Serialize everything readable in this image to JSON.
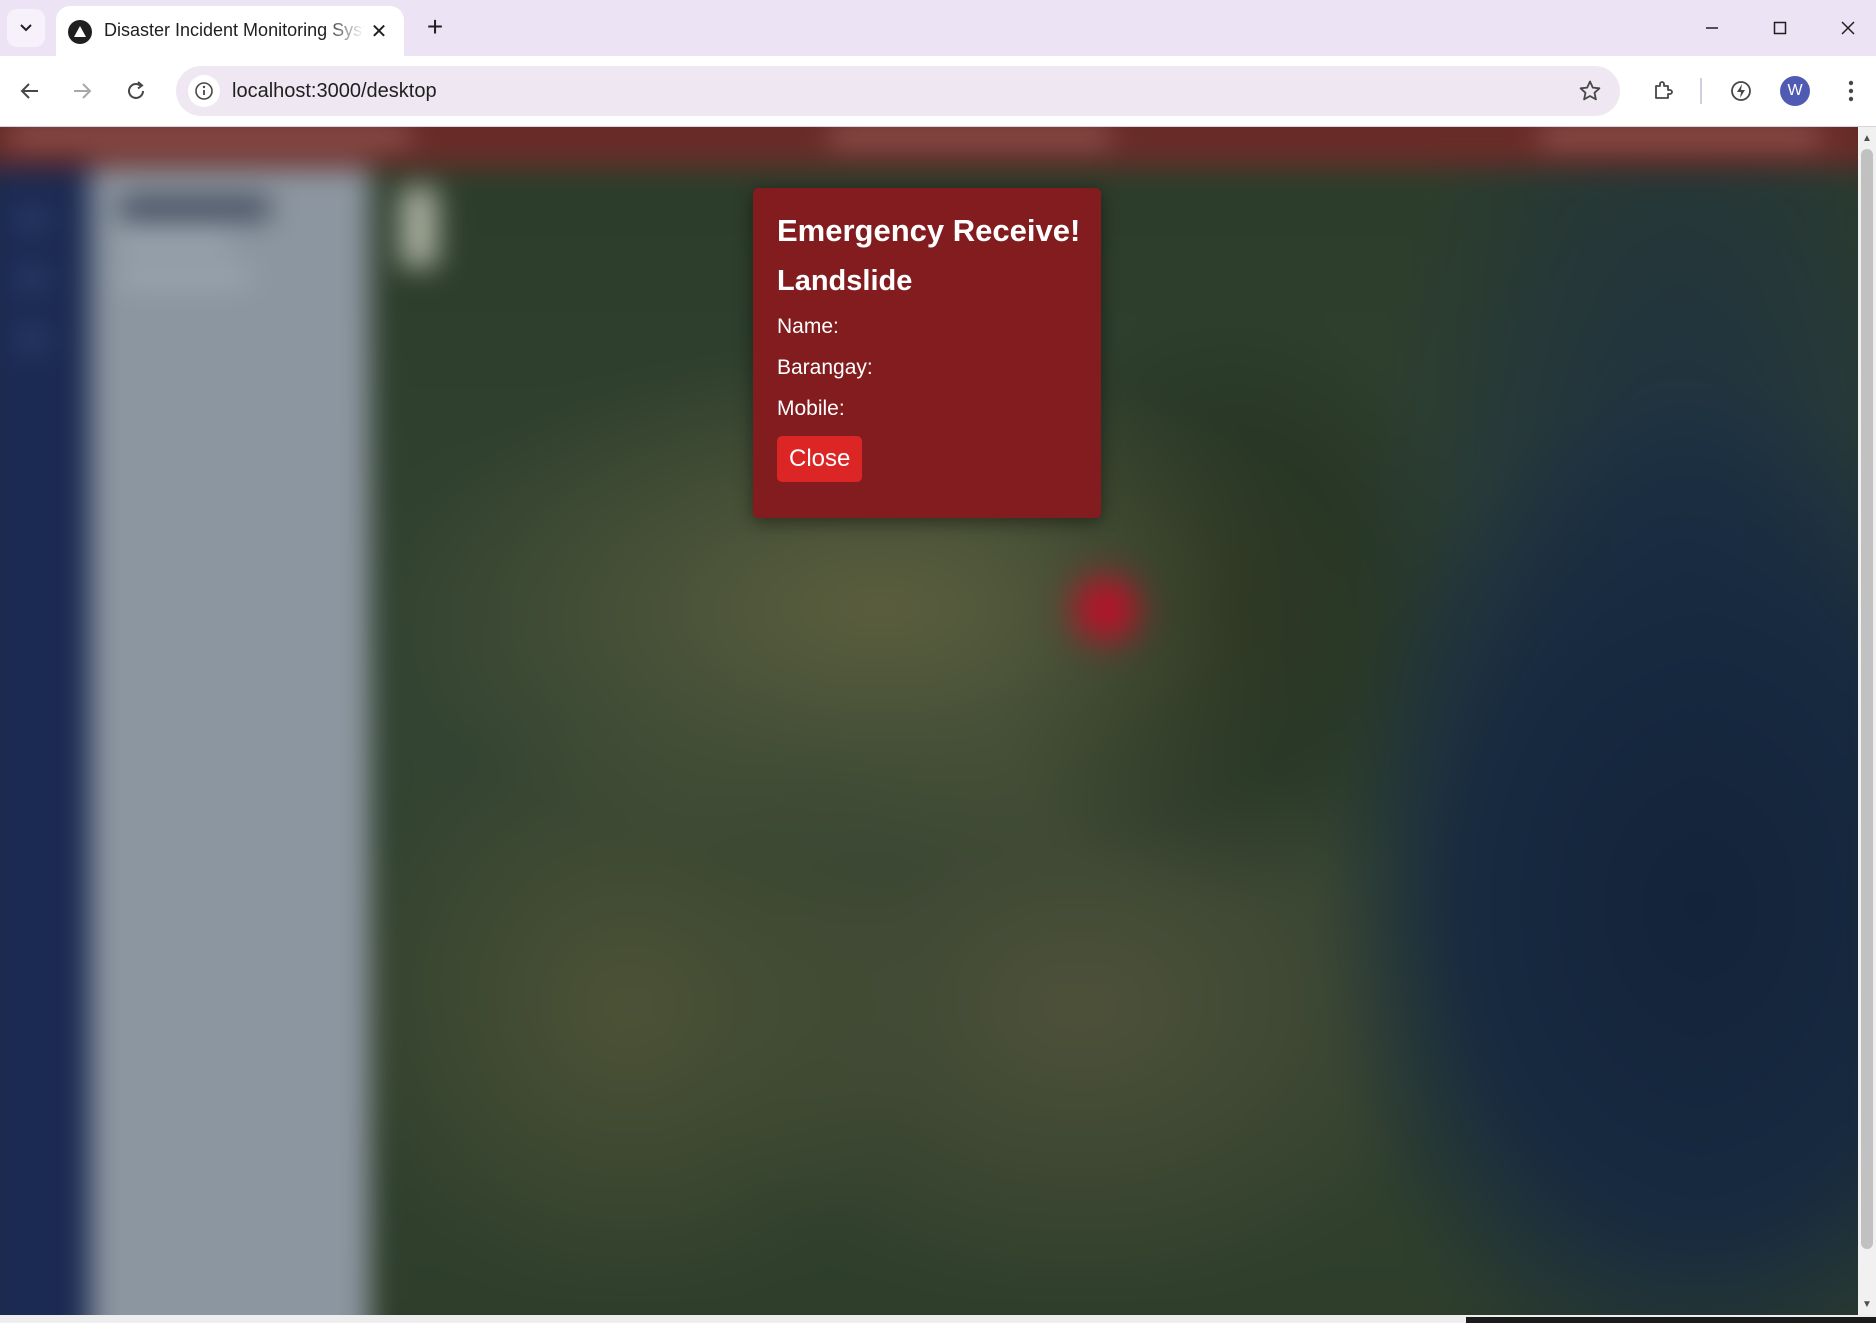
{
  "browser": {
    "tab": {
      "title": "Disaster Incident Monitoring System",
      "favicon": "triangle-logo-icon",
      "close_glyph": "✕"
    },
    "new_tab_glyph": "+",
    "tab_list_glyph": "⌄",
    "url": "localhost:3000/desktop",
    "profile_initial": "W",
    "accent_color": "#4f5bb3",
    "icons": [
      "back-arrow-icon",
      "forward-arrow-icon",
      "reload-icon",
      "site-info-icon",
      "bookmark-star-icon",
      "extensions-icon",
      "performance-icon",
      "kebab-menu-icon",
      "minimize-icon",
      "maximize-icon",
      "window-close-icon"
    ]
  },
  "popup": {
    "title": "Emergency Receive!",
    "incident_type": "Landslide",
    "name_label": "Name:",
    "barangay_label": "Barangay:",
    "mobile_label": "Mobile:",
    "close_label": "Close",
    "background_color": "#831c1f",
    "button_color": "#dc2626"
  },
  "page": {
    "header_color": "#6a2c28",
    "sidebar_color": "#1b2a52",
    "marker_color": "#b0162b"
  }
}
